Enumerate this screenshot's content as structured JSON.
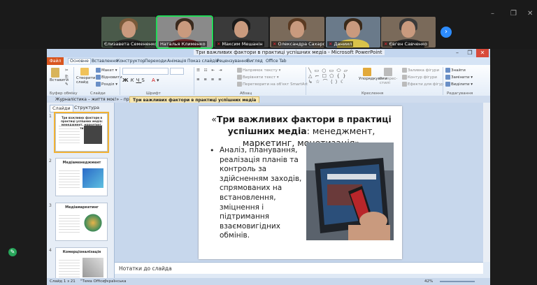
{
  "zoom": {
    "window_controls": [
      "–",
      "❐",
      "✕"
    ],
    "participants": [
      {
        "name": "Єлизавета Семененко",
        "muted": false,
        "active": false,
        "bg": "#4a5a4a",
        "hair": "#7a5a3a",
        "shirt": "#2a2a2a"
      },
      {
        "name": "Наталья Клименко",
        "muted": false,
        "active": true,
        "bg": "#8a8a8a",
        "hair": "#3a2a1e",
        "shirt": "#6a2a2a"
      },
      {
        "name": "Максим Мешанін",
        "muted": true,
        "active": false,
        "bg": "#3a3a3a",
        "hair": "#1a1a1a",
        "shirt": "#2a2a2a"
      },
      {
        "name": "Олександра Сахарова",
        "muted": true,
        "active": false,
        "bg": "#7a6a5a",
        "hair": "#5a3a22",
        "shirt": "#6a6a6a"
      },
      {
        "name": "Даниил",
        "muted": true,
        "active": false,
        "bg": "#6a7a8a",
        "hair": "#3a2a1a",
        "shirt": "#d9c34a"
      },
      {
        "name": "Євген Савченко",
        "muted": true,
        "active": false,
        "bg": "#7a6a5a",
        "hair": "#3a3a3a",
        "shirt": "#2a2a2a"
      }
    ],
    "next_arrow": "›"
  },
  "ppt": {
    "title": "Три важливих фактори в практиці успішних медіа - Microsoft PowerPoint",
    "tabs": [
      "Файл",
      "Основне",
      "Вставлення",
      "Конструктор",
      "Переходи",
      "Анімація",
      "Показ слайдів",
      "Рецензування",
      "Вигляд",
      "Office Tab"
    ],
    "ribbon": {
      "paste": "Вставити",
      "new_slide": "Створити слайд",
      "layout": "Макет",
      "reset": "Відновити",
      "section": "Розділ",
      "text_dir": "Напрямок тексту",
      "align_text": "Вирівняти текст",
      "smartart": "Перетворити на об'єкт SmartArt",
      "arrange": "Упорядкувати",
      "quick_styles": "Експрес-стилі",
      "shape_fill": "Заливка фігури",
      "shape_outline": "Контур фігури",
      "shape_effects": "Ефекти для фігур",
      "find": "Знайти",
      "replace": "Замінити",
      "select": "Виділити",
      "groups": [
        "Буфер обміну",
        "Слайди",
        "Шрифт",
        "Абзац",
        "Креслення",
        "Редагування"
      ]
    },
    "doc_tabs": [
      "Журналістика – життя моє!» – про",
      "Три важливих фактори в практиці успішних медіа"
    ],
    "pane_tabs": [
      "Слайди",
      "Структура"
    ],
    "thumbnails": [
      {
        "num": "1",
        "title": "Три важливих фактори в практиці успішних медіа: менеджмент, маркетинг, монетизація"
      },
      {
        "num": "2",
        "title": "Медіаменеджмент"
      },
      {
        "num": "3",
        "title": "Медіамаркетинг"
      },
      {
        "num": "4",
        "title": "Комерціоналізація"
      }
    ],
    "slide": {
      "q_open": "«",
      "title_bold": "Три важливих фактори в практиці успішних медіа",
      "title_rest": ": менеджмент, маркетинг, монетизація",
      "q_close": "»",
      "bullet": "Аналіз, планування, реалізація планів та контроль за здійсненням заходів, спрямованих на встановлення, зміцнення і підтримання взаємовигідних обмінів."
    },
    "notes_placeholder": "Нотатки до слайда",
    "status": {
      "slide_count": "Слайд 1 з 21",
      "theme": "\"Тема Office\"",
      "language": "українська",
      "zoom": "42%"
    }
  }
}
